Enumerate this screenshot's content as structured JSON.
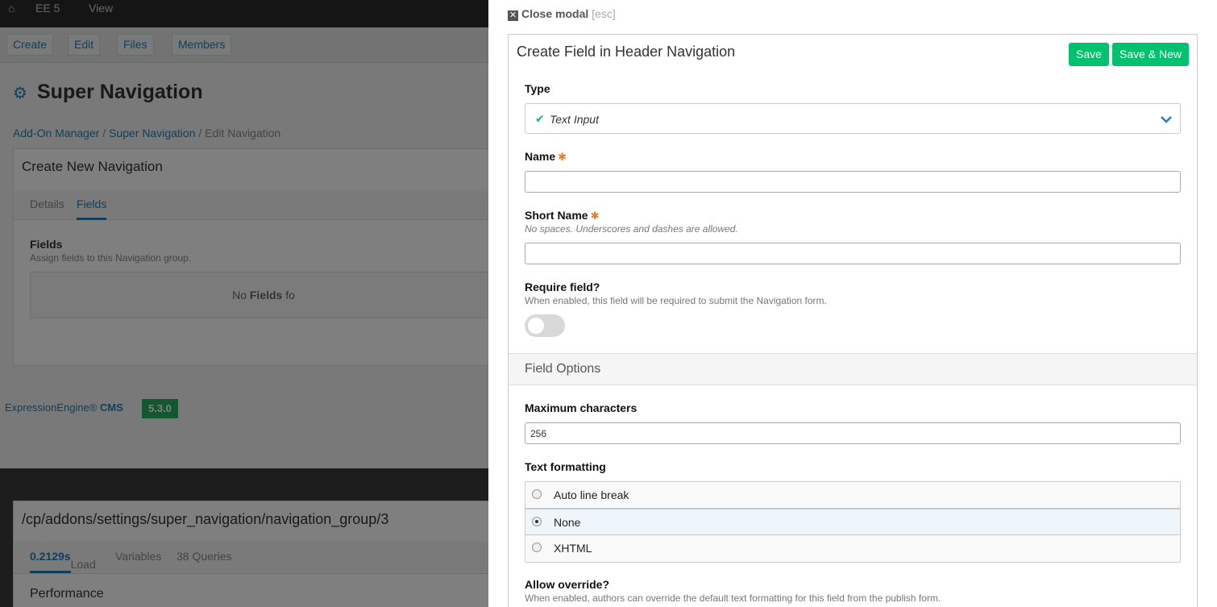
{
  "background": {
    "topbar": {
      "home_icon": "home-icon",
      "site": "EE 5",
      "view": "View"
    },
    "subnav": {
      "create": "Create",
      "edit": "Edit",
      "files": "Files",
      "members": "Members"
    },
    "page_title": "Super Navigation",
    "breadcrumb": {
      "item1": "Add-On Manager",
      "sep1": "/",
      "item2": "Super Navigation",
      "sep2": "/",
      "item3": "Edit Navigation"
    },
    "box": {
      "title": "Create New Navigation",
      "tab_details": "Details",
      "tab_fields": "Fields",
      "fields_label": "Fields",
      "fields_desc": "Assign fields to this Navigation group.",
      "empty_prefix": "No",
      "empty_bold": "Fields",
      "empty_suffix": "fo"
    },
    "footer": {
      "brand": "ExpressionEngine®",
      "brand_bold": "CMS",
      "version": "5.3.0"
    },
    "debug": {
      "path": "/cp/addons/settings/super_navigation/navigation_group/3",
      "load_bold": "0.2129s",
      "load": "Load",
      "variables": "Variables",
      "queries": "38 Queries",
      "performance": "Performance"
    }
  },
  "modal": {
    "close_label": "Close modal",
    "close_hint": "[esc]",
    "title": "Create Field in Header Navigation",
    "save": "Save",
    "save_new": "Save & New",
    "type": {
      "label": "Type",
      "value": "Text Input"
    },
    "name": {
      "label": "Name",
      "required_mark": "✱",
      "value": ""
    },
    "short_name": {
      "label": "Short Name",
      "required_mark": "✱",
      "desc": "No spaces. Underscores and dashes are allowed.",
      "value": ""
    },
    "require_field": {
      "label": "Require field?",
      "desc": "When enabled, this field will be required to submit the Navigation form.",
      "on": false
    },
    "field_options": "Field Options",
    "max_chars": {
      "label": "Maximum characters",
      "value": "256"
    },
    "text_formatting": {
      "label": "Text formatting",
      "options": [
        "Auto line break",
        "None",
        "XHTML"
      ],
      "selected": "None"
    },
    "allow_override": {
      "label": "Allow override?",
      "desc": "When enabled, authors can override the default text formatting for this field from the publish form."
    }
  }
}
